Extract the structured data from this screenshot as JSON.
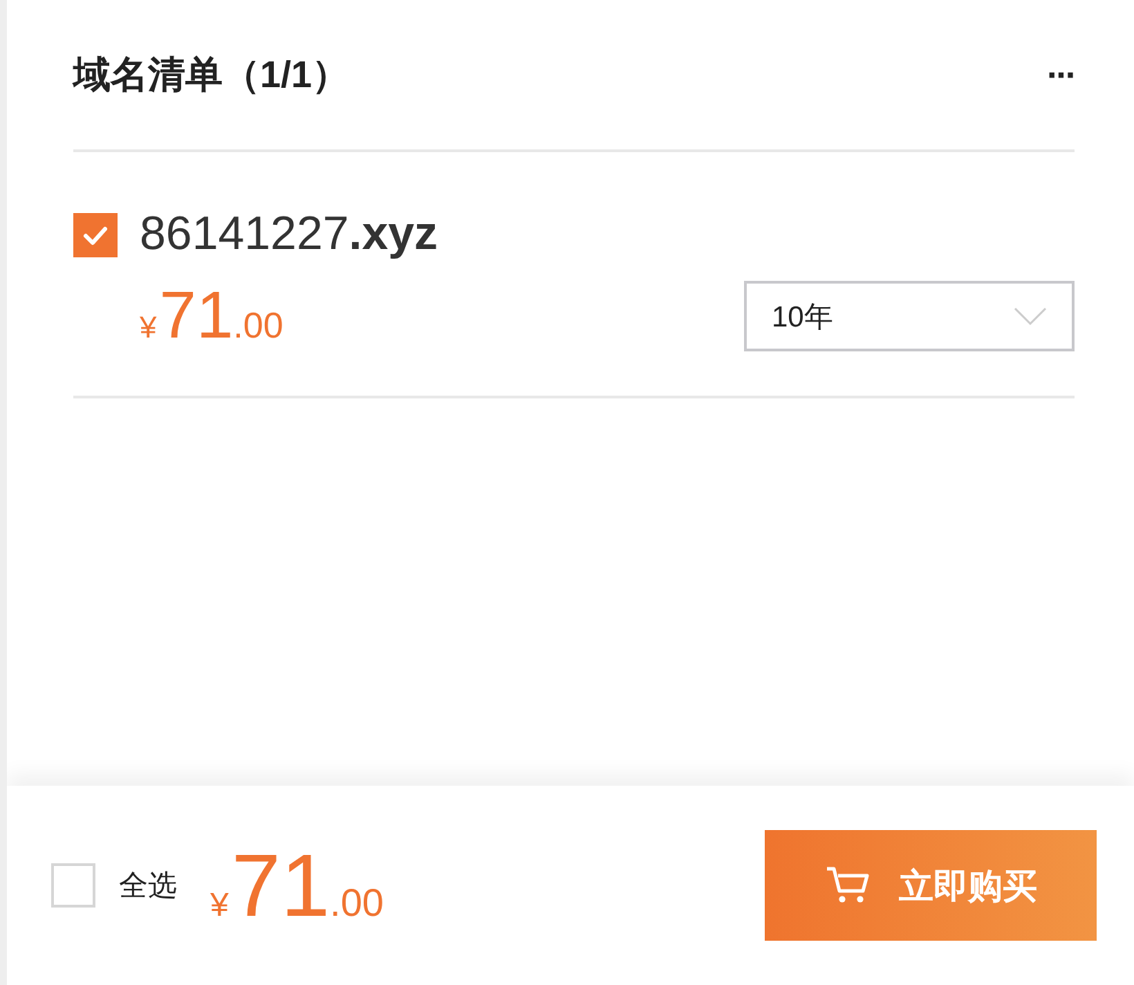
{
  "header": {
    "title": "域名清单（1/1）",
    "menu": "···"
  },
  "items": [
    {
      "domain": "86141227**.xyz**",
      "checked": true,
      "currency": "¥",
      "price_int": "71",
      "price_dec": ".00",
      "period": "10年"
    }
  ],
  "footer": {
    "select_all": {
      "label": "全选",
      "checked": false
    },
    "currency": "¥",
    "total_int": "71",
    "total_dec": ".00",
    "buy_button": "立即购买"
  }
}
